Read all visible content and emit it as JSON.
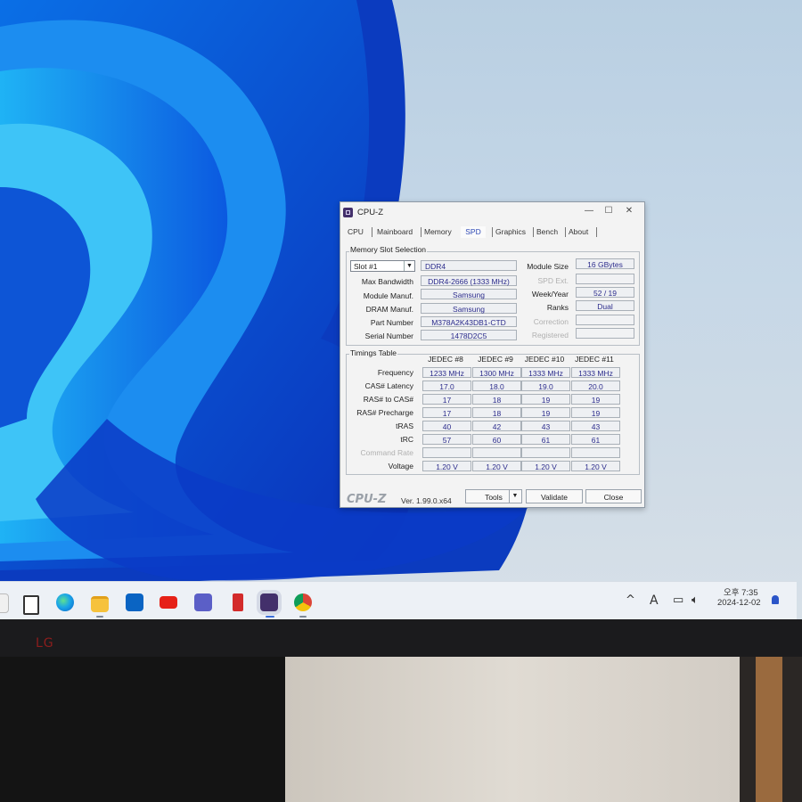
{
  "window": {
    "title": "CPU-Z",
    "controls": {
      "minimize": "—",
      "maximize": "☐",
      "close": "✕"
    }
  },
  "tabs": [
    {
      "label": "CPU",
      "active": false
    },
    {
      "label": "Mainboard",
      "active": false
    },
    {
      "label": "Memory",
      "active": false
    },
    {
      "label": "SPD",
      "active": true
    },
    {
      "label": "Graphics",
      "active": false
    },
    {
      "label": "Bench",
      "active": false
    },
    {
      "label": "About",
      "active": false
    }
  ],
  "slot_section": {
    "title": "Memory Slot Selection",
    "slot_value": "Slot #1",
    "type": "DDR4",
    "fields": {
      "max_bandwidth_label": "Max Bandwidth",
      "max_bandwidth": "DDR4-2666 (1333 MHz)",
      "module_manuf_label": "Module Manuf.",
      "module_manuf": "Samsung",
      "dram_manuf_label": "DRAM Manuf.",
      "dram_manuf": "Samsung",
      "part_number_label": "Part Number",
      "part_number": "M378A2K43DB1-CTD",
      "serial_number_label": "Serial Number",
      "serial_number": "1478D2C5",
      "module_size_label": "Module Size",
      "module_size": "16 GBytes",
      "spd_ext_label": "SPD Ext.",
      "spd_ext": "",
      "week_year_label": "Week/Year",
      "week_year": "52 / 19",
      "ranks_label": "Ranks",
      "ranks": "Dual",
      "correction_label": "Correction",
      "correction": "",
      "registered_label": "Registered",
      "registered": ""
    }
  },
  "timings": {
    "title": "Timings Table",
    "columns": [
      "JEDEC #8",
      "JEDEC #9",
      "JEDEC #10",
      "JEDEC #11"
    ],
    "rows": [
      {
        "label": "Frequency",
        "values": [
          "1233 MHz",
          "1300 MHz",
          "1333 MHz",
          "1333 MHz"
        ]
      },
      {
        "label": "CAS# Latency",
        "values": [
          "17.0",
          "18.0",
          "19.0",
          "20.0"
        ]
      },
      {
        "label": "RAS# to CAS#",
        "values": [
          "17",
          "18",
          "19",
          "19"
        ]
      },
      {
        "label": "RAS# Precharge",
        "values": [
          "17",
          "18",
          "19",
          "19"
        ]
      },
      {
        "label": "tRAS",
        "values": [
          "40",
          "42",
          "43",
          "43"
        ]
      },
      {
        "label": "tRC",
        "values": [
          "57",
          "60",
          "61",
          "61"
        ]
      },
      {
        "label": "Command Rate",
        "values": [
          "",
          "",
          "",
          ""
        ]
      },
      {
        "label": "Voltage",
        "values": [
          "1.20 V",
          "1.20 V",
          "1.20 V",
          "1.20 V"
        ]
      }
    ]
  },
  "footer": {
    "logo": "CPU-Z",
    "version": "Ver. 1.99.0.x64",
    "tools": "Tools",
    "validate": "Validate",
    "close": "Close"
  },
  "taskbar": {
    "apps": [
      "start",
      "search",
      "edge",
      "file-explorer",
      "outlook",
      "youtube",
      "teams",
      "app",
      "cpu-z",
      "chrome"
    ],
    "tray": {
      "chevron": "^",
      "ime": "A",
      "time": "오후 7:35",
      "date": "2024-12-02"
    }
  },
  "bezel": {
    "brand": "LG"
  }
}
